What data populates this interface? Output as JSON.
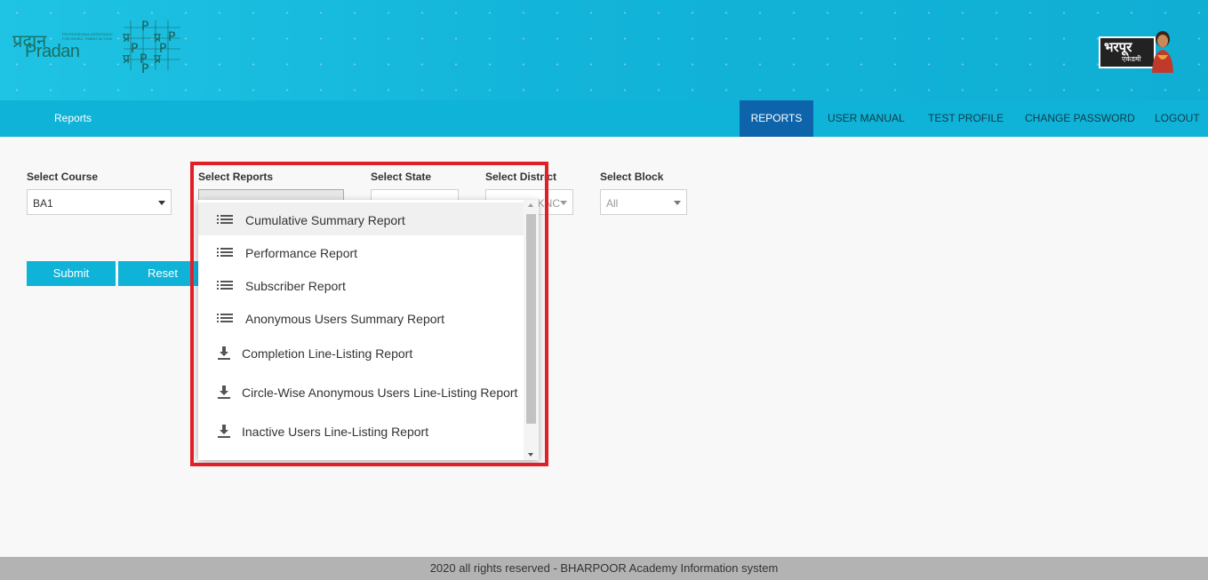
{
  "header": {
    "logo_pradan_hindi": "प्रदान",
    "logo_pradan_text": "Pradan",
    "logo_pradan_tagline": "PROFESSIONAL ASSISTANCE FOR DEVELOPMENT ACTION",
    "logo_bharpoor_text": "भरपूर",
    "logo_bharpoor_sub": "एकेडमी"
  },
  "navbar": {
    "title": "Reports",
    "items": [
      {
        "label": "REPORTS",
        "active": true
      },
      {
        "label": "USER MANUAL",
        "active": false
      },
      {
        "label": "TEST PROFILE",
        "active": false
      },
      {
        "label": "CHANGE PASSWORD",
        "active": false
      },
      {
        "label": "LOGOUT",
        "active": false
      }
    ]
  },
  "form": {
    "course": {
      "label": "Select Course",
      "value": "BA1"
    },
    "reports": {
      "label": "Select Reports",
      "value": ""
    },
    "state": {
      "label": "Select State",
      "value": ""
    },
    "district": {
      "label": "Select District",
      "value": "KNC"
    },
    "block": {
      "label": "Select Block",
      "value": "All"
    },
    "submit_label": "Submit",
    "reset_label": "Reset"
  },
  "dropdown": {
    "items": [
      {
        "label": "Cumulative Summary Report",
        "icon": "list-icon",
        "hover": true
      },
      {
        "label": "Performance Report",
        "icon": "list-icon"
      },
      {
        "label": "Subscriber Report",
        "icon": "list-icon"
      },
      {
        "label": "Anonymous Users Summary Report",
        "icon": "list-icon"
      },
      {
        "label": "Completion Line-Listing Report",
        "icon": "download-icon"
      },
      {
        "label": "Circle-Wise Anonymous Users Line-Listing Report",
        "icon": "download-icon"
      },
      {
        "label": "Inactive Users Line-Listing Report",
        "icon": "download-icon"
      }
    ]
  },
  "footer": {
    "text": "2020 all rights reserved - BHARPOOR Academy Information system"
  },
  "colors": {
    "accent": "#10b3d8",
    "nav_active": "#0d64aa",
    "highlight": "#e11f26"
  }
}
